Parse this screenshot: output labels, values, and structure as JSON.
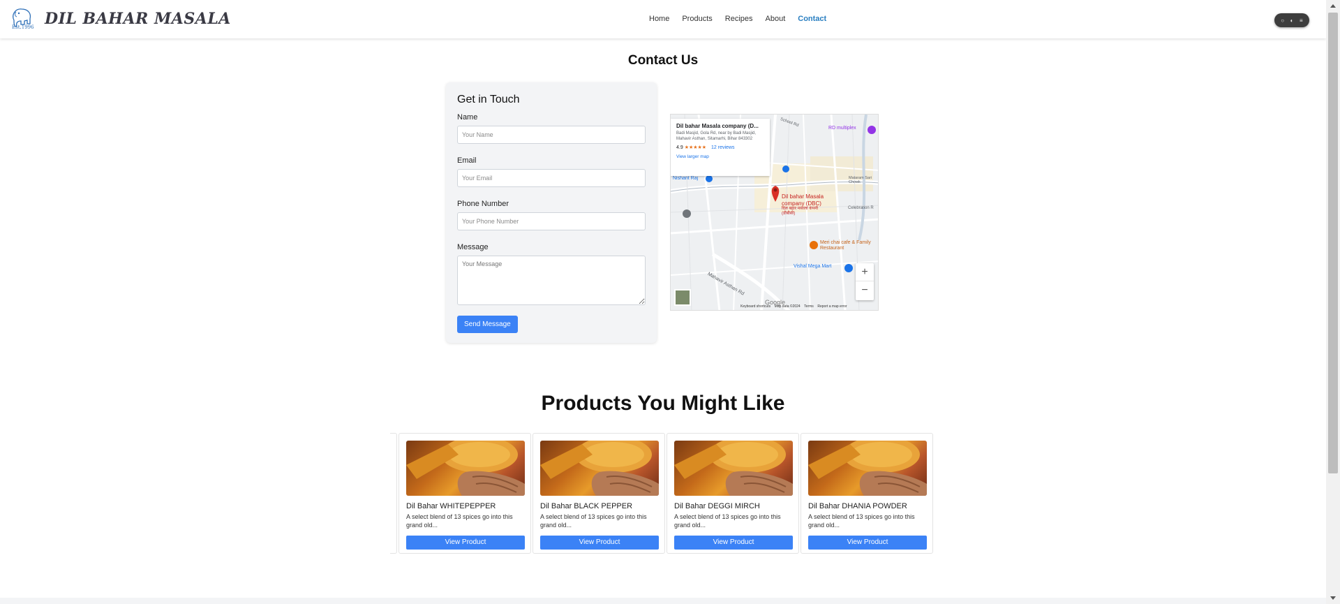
{
  "brand": {
    "name": "DIL BAHAR MASALA",
    "est": "Est.1996"
  },
  "nav": {
    "items": [
      {
        "label": "Home",
        "active": false
      },
      {
        "label": "Products",
        "active": false
      },
      {
        "label": "Recipes",
        "active": false
      },
      {
        "label": "About",
        "active": false
      },
      {
        "label": "Contact",
        "active": true
      }
    ]
  },
  "page": {
    "title": "Contact Us"
  },
  "form": {
    "title": "Get in Touch",
    "name_label": "Name",
    "name_placeholder": "Your Name",
    "email_label": "Email",
    "email_placeholder": "Your Email",
    "phone_label": "Phone Number",
    "phone_placeholder": "Your Phone Number",
    "message_label": "Message",
    "message_placeholder": "Your Message",
    "submit_label": "Send Message"
  },
  "map": {
    "place_name": "Dil bahar Masala company (D...",
    "address": "Badi Masjid, Gola Rd, near by Badi Masjid, Mahavir Asthan, Sitamarhi, Bihar 843302",
    "rating": "4.9",
    "stars": "★★★★★",
    "reviews": "12 reviews",
    "larger_map": "View larger map",
    "pin_label": "Dil bahar Masala company (DBC)",
    "pin_label_hindi": "दिल बहार मसाला कंपनी (डीबीसी)",
    "poi_1": "RD multiplex",
    "poi_2": "Meri chai cafe & Family Restaurant",
    "poi_3": "Vishal Mega Mart",
    "poi_4": "Nishant Raj",
    "poi_5": "Celebration R",
    "poi_6": "Mataram Sari Chowk",
    "street_1": "Mahavir Asthan Rd",
    "street_2": "School Rd",
    "zoom_in": "+",
    "zoom_out": "−",
    "google": "Google",
    "footer_shortcuts": "Keyboard shortcuts",
    "footer_data": "Map data ©2024",
    "footer_terms": "Terms",
    "footer_report": "Report a map error"
  },
  "products": {
    "title": "Products You Might Like",
    "items": [
      {
        "name": "Dil Bahar WHITEPEPPER",
        "desc": "A select blend of 13 spices go into this grand old...",
        "button": "View Product"
      },
      {
        "name": "Dil Bahar BLACK PEPPER",
        "desc": "A select blend of 13 spices go into this grand old...",
        "button": "View Product"
      },
      {
        "name": "Dil Bahar DEGGI MIRCH",
        "desc": "A select blend of 13 spices go into this grand old...",
        "button": "View Product"
      },
      {
        "name": "Dil Bahar DHANIA POWDER",
        "desc": "A select blend of 13 spices go into this grand old...",
        "button": "View Product"
      }
    ]
  },
  "colors": {
    "accent": "#3b82f6",
    "nav_active": "#2a7fc1",
    "card_bg": "#f3f4f6"
  },
  "icons": {
    "widget": [
      "chat-icon",
      "toggle-icon",
      "menu-icon"
    ],
    "logo": "elephant-icon"
  }
}
